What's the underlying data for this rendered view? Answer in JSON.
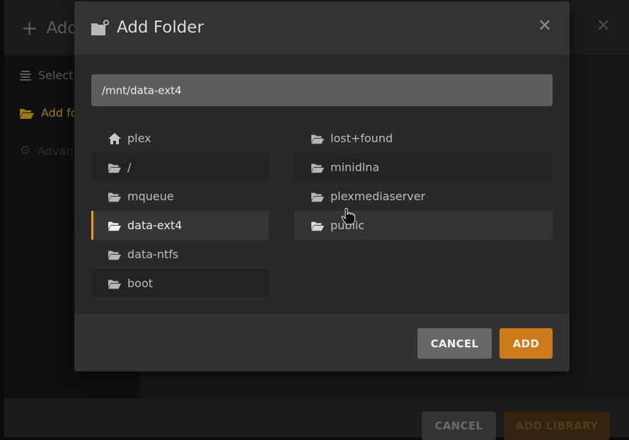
{
  "background_dialog": {
    "title": "Add",
    "sidebar": [
      {
        "label": "Select",
        "icon": "list-icon"
      },
      {
        "label": "Add fo",
        "icon": "folder-open-icon",
        "active": true
      },
      {
        "label": "Advan",
        "icon": "gear-icon"
      }
    ],
    "buttons": {
      "cancel": "CANCEL",
      "add_library": "ADD LIBRARY"
    }
  },
  "modal": {
    "title": "Add Folder",
    "title_icon": "folder-add-icon",
    "close_icon": "close-icon",
    "path_value": "/mnt/data-ext4",
    "left_list": [
      {
        "label": "plex",
        "icon": "home-icon"
      },
      {
        "label": "/",
        "icon": "folder-open-icon"
      },
      {
        "label": "mqueue",
        "icon": "folder-open-icon"
      },
      {
        "label": "data-ext4",
        "icon": "folder-open-icon",
        "selected": true
      },
      {
        "label": "data-ntfs",
        "icon": "folder-open-icon"
      },
      {
        "label": "boot",
        "icon": "folder-open-icon"
      }
    ],
    "right_list": [
      {
        "label": "lost+found",
        "icon": "folder-open-icon"
      },
      {
        "label": "minidlna",
        "icon": "folder-open-icon"
      },
      {
        "label": "plexmediaserver",
        "icon": "folder-open-icon"
      },
      {
        "label": "public",
        "icon": "folder-open-icon",
        "hovered": true
      }
    ],
    "buttons": {
      "cancel": "CANCEL",
      "add": "ADD"
    }
  },
  "colors": {
    "accent": "#e5a00d",
    "add_button": "#cc7b19",
    "cancel_button": "#676767"
  }
}
